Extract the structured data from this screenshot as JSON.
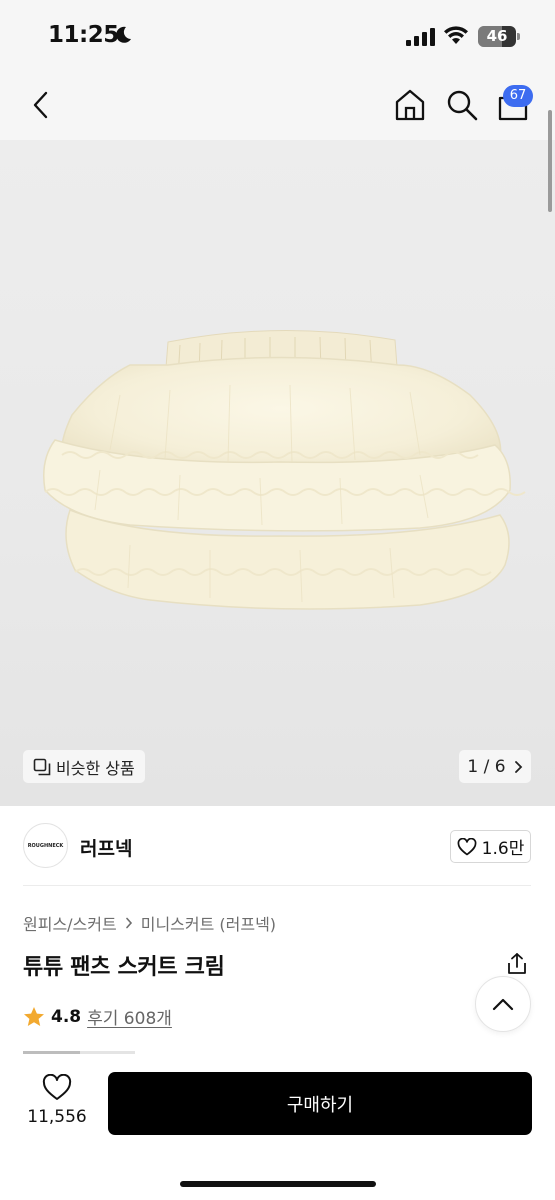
{
  "status_bar": {
    "time": "11:25",
    "battery": "46"
  },
  "nav": {
    "back_icon": "chevron-left-icon",
    "home_icon": "home-icon",
    "search_icon": "search-icon",
    "cart_icon": "bag-icon",
    "cart_count": "67",
    "badge_color": "#3d6cf0"
  },
  "gallery": {
    "similar_label": "비슷한 상품",
    "pager": "1 / 6"
  },
  "brand": {
    "logo_text": "ROUGHNECK",
    "name": "러프넥",
    "likes": "1.6만"
  },
  "product": {
    "breadcrumb": [
      "원피스/스커트",
      "미니스커트 (러프넥)"
    ],
    "title": "튜튜 팬츠 스커트 크림",
    "rating": "4.8",
    "reviews": "후기 608개",
    "star_color": "#f2a92f"
  },
  "bottom_bar": {
    "wish_count": "11,556",
    "buy_label": "구매하기"
  }
}
